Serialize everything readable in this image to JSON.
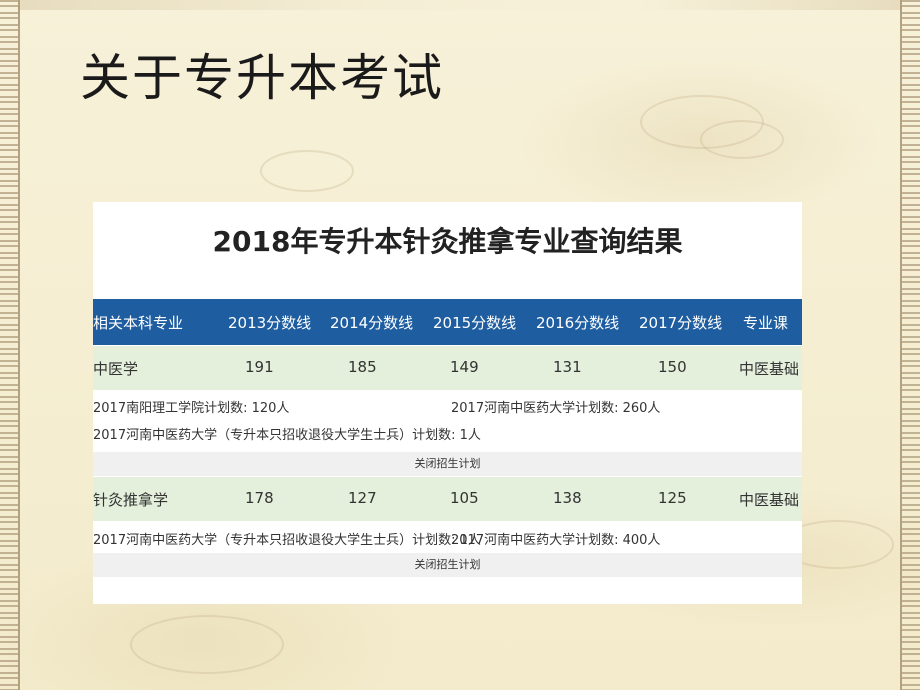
{
  "slide": {
    "title": "关于专升本考试"
  },
  "result": {
    "title": "2018年专升本针灸推拿专业查询结果",
    "columns": [
      "相关本科专业",
      "2013分数线",
      "2014分数线",
      "2015分数线",
      "2016分数线",
      "2017分数线",
      "专业课"
    ],
    "rows": [
      {
        "major": "中医学",
        "scores": [
          "191",
          "185",
          "149",
          "131",
          "150"
        ],
        "course": "中医基础",
        "plans_left": [
          "2017南阳理工学院计划数: 120人",
          "2017河南中医药大学（专升本只招收退役大学生士兵）计划数: 1人"
        ],
        "plans_right": [
          "2017河南中医药大学计划数: 260人"
        ],
        "close_label": "关闭招生计划"
      },
      {
        "major": "针灸推拿学",
        "scores": [
          "178",
          "127",
          "105",
          "138",
          "125"
        ],
        "course": "中医基础",
        "plans_left": [
          "2017河南中医药大学（专升本只招收退役大学生士兵）计划数: 1人"
        ],
        "plans_right": [
          "2017河南中医药大学计划数: 400人"
        ],
        "close_label": "关闭招生计划"
      }
    ]
  },
  "colors": {
    "header_bg": "#1e5da0",
    "major_row_bg": "#e4efdc",
    "slide_bg": "#f6efd3"
  }
}
